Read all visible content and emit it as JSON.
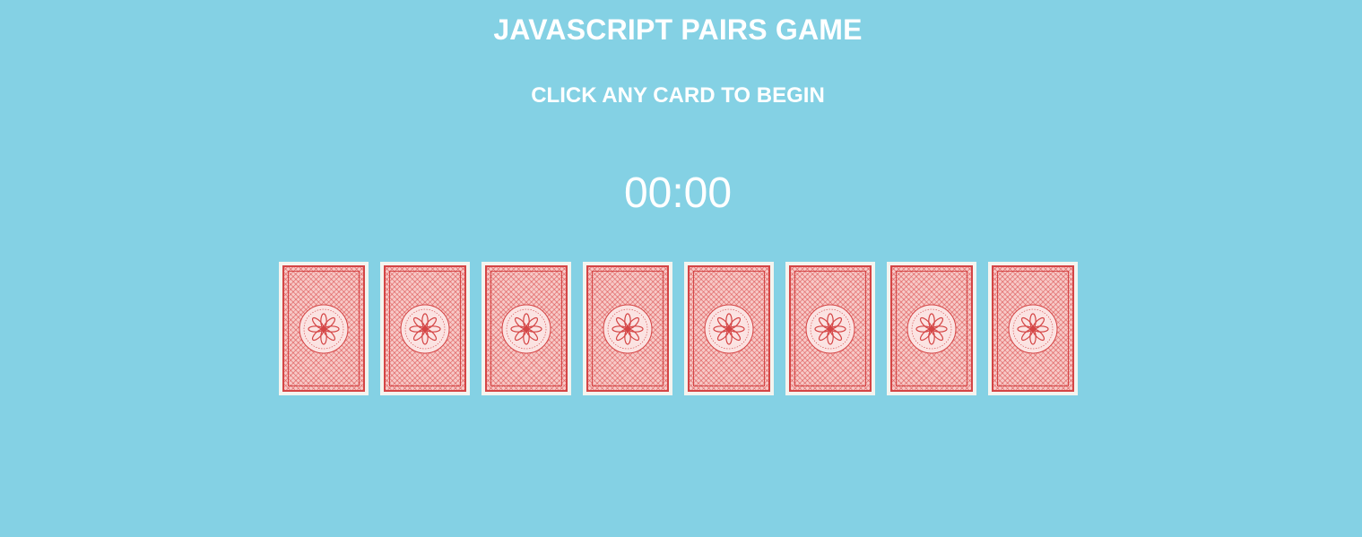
{
  "header": {
    "title": "JAVASCRIPT PAIRS GAME",
    "instruction": "CLICK ANY CARD TO BEGIN"
  },
  "timer": {
    "display": "00:00"
  },
  "cards": [
    {
      "state": "face-down"
    },
    {
      "state": "face-down"
    },
    {
      "state": "face-down"
    },
    {
      "state": "face-down"
    },
    {
      "state": "face-down"
    },
    {
      "state": "face-down"
    },
    {
      "state": "face-down"
    },
    {
      "state": "face-down"
    }
  ],
  "colors": {
    "background": "#84d1e4",
    "text": "#ffffff",
    "card_frame": "#f4f4ef",
    "card_pattern": "#d44545"
  }
}
